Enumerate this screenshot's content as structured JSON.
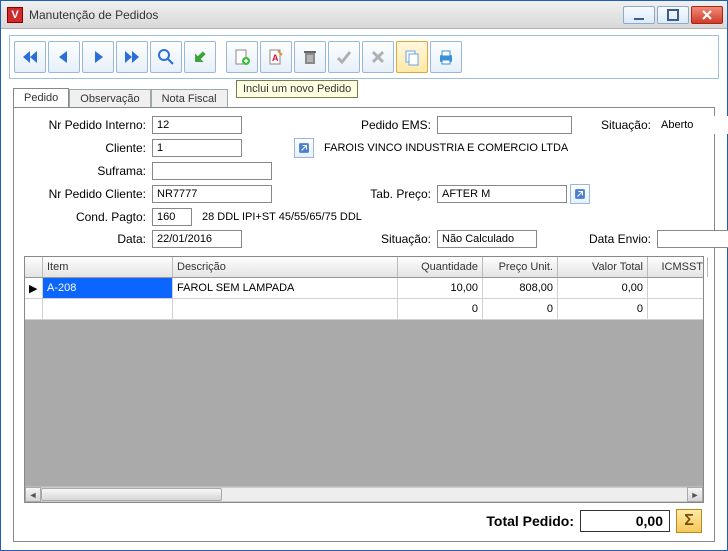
{
  "window": {
    "title": "Manutenção de Pedidos"
  },
  "toolbar": {
    "tooltip_new": "Inclui um novo Pedido"
  },
  "tabs": {
    "pedido": "Pedido",
    "observacao": "Observação",
    "nota_fiscal": "Nota Fiscal"
  },
  "form": {
    "labels": {
      "nr_pedido_interno": "Nr Pedido Interno:",
      "pedido_ems": "Pedido EMS:",
      "situacao": "Situação:",
      "cliente": "Cliente:",
      "suframa": "Suframa:",
      "nr_pedido_cliente": "Nr Pedido Cliente:",
      "tab_preco": "Tab. Preço:",
      "cond_pagto": "Cond. Pagto:",
      "data": "Data:",
      "situacao2": "Situação:",
      "data_envio": "Data Envio:"
    },
    "values": {
      "nr_pedido_interno": "12",
      "pedido_ems": "",
      "situacao": "Aberto",
      "cliente_cod": "1",
      "cliente_nome": "FAROIS VINCO INDUSTRIA E COMERCIO LTDA",
      "suframa": "",
      "nr_pedido_cliente": "NR7777",
      "tab_preco": "AFTER M",
      "cond_pagto_cod": "160",
      "cond_pagto_desc": "28 DDL IPI+ST 45/55/65/75 DDL",
      "data": "22/01/2016",
      "situacao2": "Não Calculado",
      "data_envio": ""
    }
  },
  "grid": {
    "columns": {
      "item": "Item",
      "descricao": "Descrição",
      "quantidade": "Quantidade",
      "preco_unit": "Preço Unit.",
      "valor_total": "Valor Total",
      "icmsst": "ICMSST"
    },
    "rows": [
      {
        "item": "A-208",
        "descricao": "FAROL SEM LAMPADA",
        "quantidade": "10,00",
        "preco_unit": "808,00",
        "valor_total": "0,00",
        "icmsst": ""
      },
      {
        "item": "",
        "descricao": "",
        "quantidade": "0",
        "preco_unit": "0",
        "valor_total": "0",
        "icmsst": ""
      }
    ]
  },
  "footer": {
    "label": "Total Pedido:",
    "value": "0,00"
  }
}
